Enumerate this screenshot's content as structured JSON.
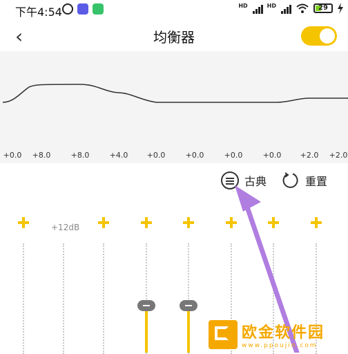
{
  "status": {
    "time": "下午4:54",
    "left_icons": [
      "alarm-icon",
      "app-icon-blue",
      "app-icon-green"
    ],
    "signal_labels": [
      "HD",
      "HD"
    ],
    "battery": "29"
  },
  "header": {
    "back": "‹",
    "title": "均衡器",
    "toggle_on": true
  },
  "frequencies": [
    "+0.0",
    "+8.0",
    "+8.0",
    "+4.0",
    "+0.0",
    "+0.0",
    "+0.0",
    "+0.0",
    "+2.0",
    "+2.0"
  ],
  "actions": {
    "preset_label": "古典",
    "reset_label": "重置"
  },
  "sliders": {
    "db_label": "+12dB"
  },
  "watermark": {
    "text": "欧金软件园",
    "url": "www.ppoujin.com"
  },
  "colors": {
    "accent": "#f5c400",
    "arrow": "#b07de0",
    "curve_bg": "#f4f4f4"
  }
}
